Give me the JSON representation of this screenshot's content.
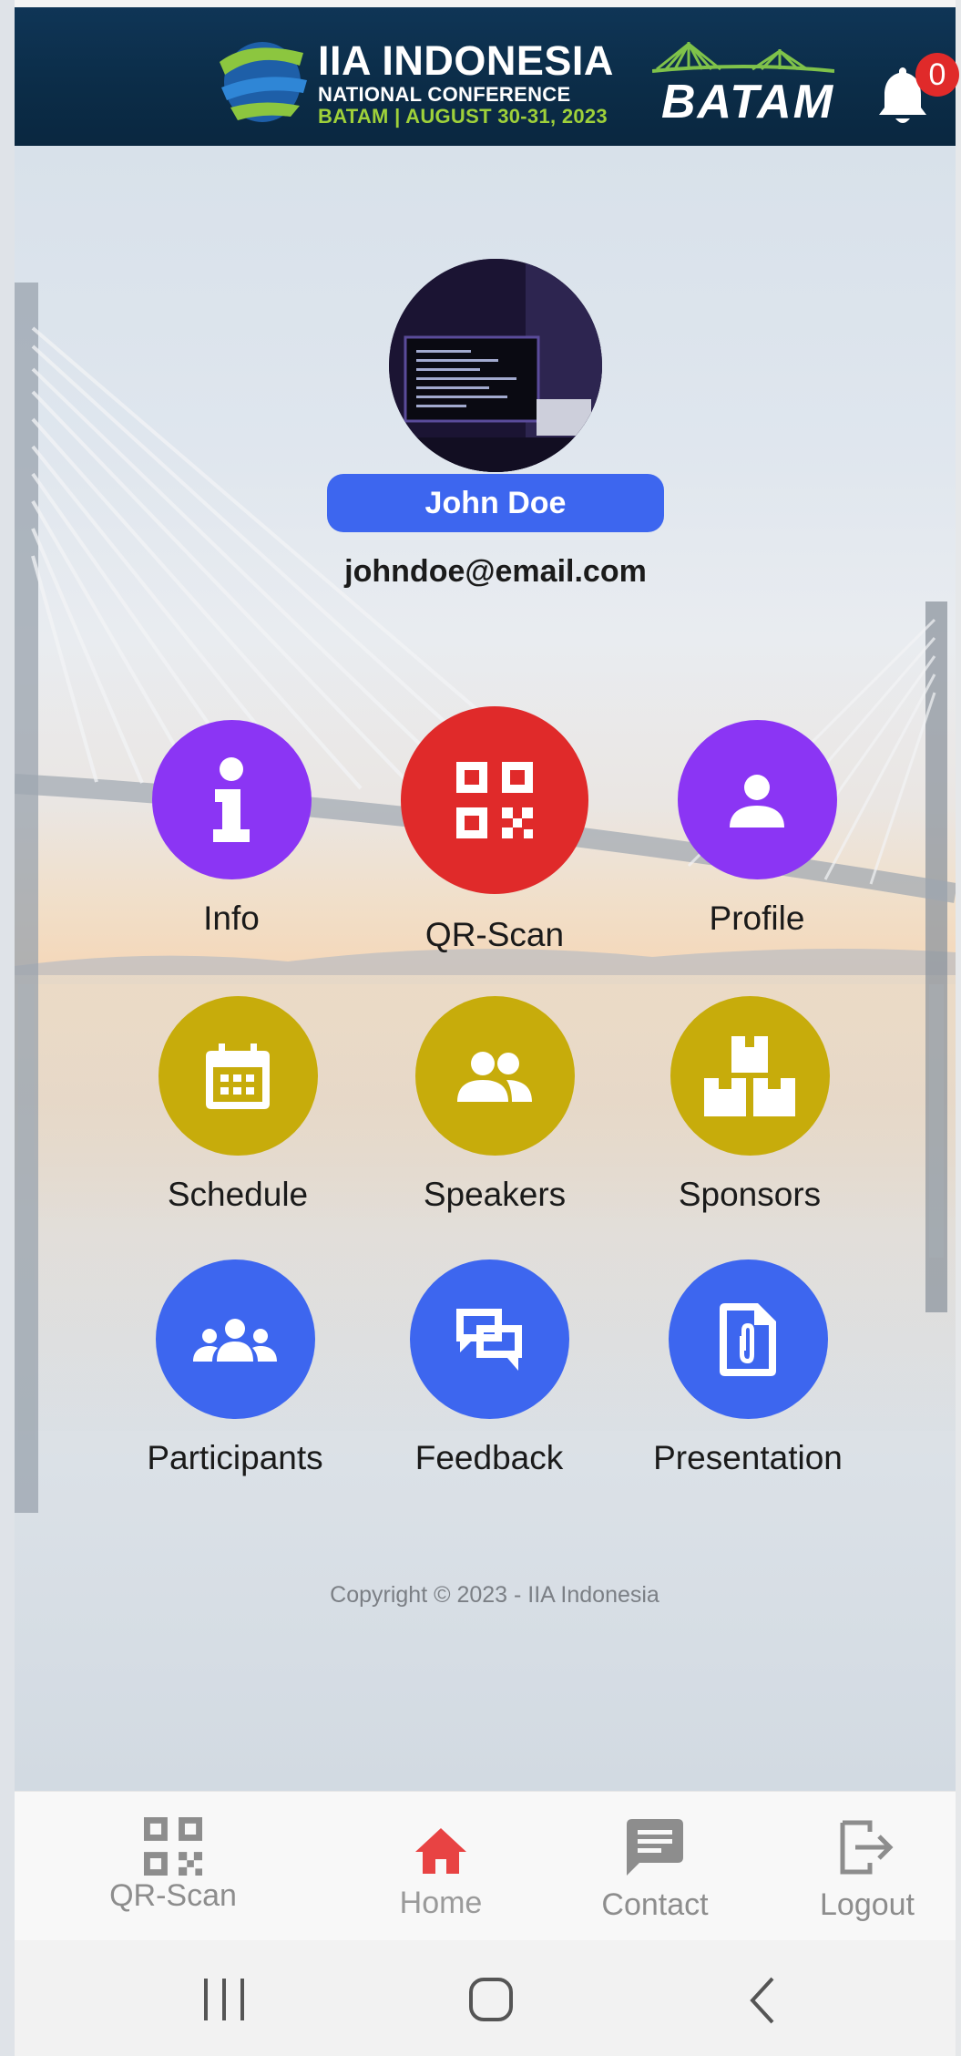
{
  "header": {
    "logo_title": "IIA INDONESIA",
    "logo_sub1": "NATIONAL CONFERENCE",
    "logo_sub2": "BATAM | AUGUST 30-31, 2023",
    "city_mark": "BATAM",
    "notification_count": "0"
  },
  "profile": {
    "name": "John Doe",
    "email": "johndoe@email.com"
  },
  "menu": [
    {
      "label": "Info",
      "color": "#8b35f4",
      "icon": "info-icon"
    },
    {
      "label": "QR-Scan",
      "color": "#e02a2a",
      "icon": "qr-code-icon"
    },
    {
      "label": "Profile",
      "color": "#8b35f4",
      "icon": "person-icon"
    },
    {
      "label": "Schedule",
      "color": "#c7ac0b",
      "icon": "calendar-icon"
    },
    {
      "label": "Speakers",
      "color": "#c7ac0b",
      "icon": "people-icon"
    },
    {
      "label": "Sponsors",
      "color": "#c7ac0b",
      "icon": "boxes-icon"
    },
    {
      "label": "Participants",
      "color": "#3d66ef",
      "icon": "group-icon"
    },
    {
      "label": "Feedback",
      "color": "#3d66ef",
      "icon": "chat-icon"
    },
    {
      "label": "Presentation",
      "color": "#3d66ef",
      "icon": "attachment-file-icon"
    }
  ],
  "copyright": "Copyright © 2023 - IIA Indonesia",
  "bottom_nav": [
    {
      "label": "QR-Scan",
      "icon": "qr-code-icon"
    },
    {
      "label": "Home",
      "icon": "home-icon",
      "active": true
    },
    {
      "label": "Contact",
      "icon": "message-icon"
    },
    {
      "label": "Logout",
      "icon": "logout-icon"
    }
  ],
  "colors": {
    "header_bg": "#0b2c47",
    "accent_blue": "#3d66ef",
    "active_nav": "#e84343"
  }
}
